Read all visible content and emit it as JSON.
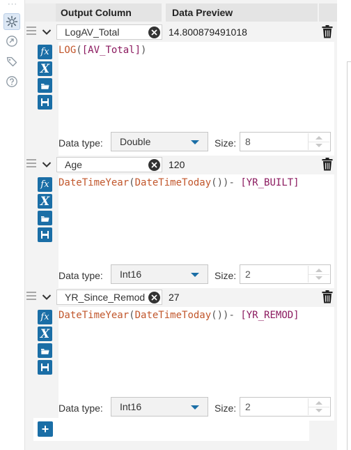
{
  "header": {
    "output_column": "Output Column",
    "data_preview": "Data Preview"
  },
  "rail": {
    "icons": [
      "settings-icon",
      "navigate-icon",
      "tag-icon",
      "help-icon"
    ]
  },
  "fields": [
    {
      "name": "LogAV_Total",
      "preview": "14.800879491018",
      "expression": [
        {
          "t": "LOG",
          "k": "fn"
        },
        {
          "t": "(",
          "k": "p"
        },
        {
          "t": "[AV_Total]",
          "k": "f"
        },
        {
          "t": ")",
          "k": "p"
        }
      ],
      "data_type_label": "Data type:",
      "data_type": "Double",
      "size_label": "Size:",
      "size": "8"
    },
    {
      "name": "Age",
      "preview": "120",
      "expression": [
        {
          "t": "DateTimeYear",
          "k": "fn"
        },
        {
          "t": "(",
          "k": "p"
        },
        {
          "t": "DateTimeToday",
          "k": "fn"
        },
        {
          "t": "())- ",
          "k": "p"
        },
        {
          "t": "[YR_BUILT]",
          "k": "f"
        }
      ],
      "data_type_label": "Data type:",
      "data_type": "Int16",
      "size_label": "Size:",
      "size": "2"
    },
    {
      "name": "YR_Since_Remod",
      "preview": "27",
      "expression": [
        {
          "t": "DateTimeYear",
          "k": "fn"
        },
        {
          "t": "(",
          "k": "p"
        },
        {
          "t": "DateTimeToday",
          "k": "fn"
        },
        {
          "t": "())- ",
          "k": "p"
        },
        {
          "t": "[YR_REMOD]",
          "k": "f"
        }
      ],
      "data_type_label": "Data type:",
      "data_type": "Int16",
      "size_label": "Size:",
      "size": "2"
    }
  ],
  "add_button_label": "+",
  "colors": {
    "accent": "#1a6ea6",
    "function_text": "#c1562b",
    "field_text": "#8b1a5f"
  }
}
